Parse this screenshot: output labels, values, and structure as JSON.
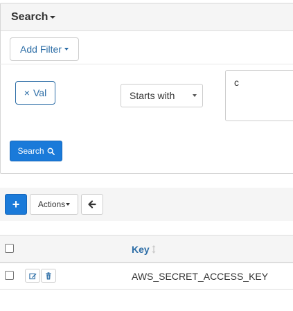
{
  "search": {
    "title": "Search",
    "add_filter_label": "Add Filter",
    "filter_tag_label": "Val",
    "filter_tag_remove": "×",
    "operator_selected": "Starts with",
    "value": "c",
    "search_button_label": "Search"
  },
  "toolbar": {
    "add_label": "+",
    "actions_label": "Actions"
  },
  "table": {
    "columns": [
      "Key"
    ],
    "rows": [
      {
        "key": "AWS_SECRET_ACCESS_KEY"
      }
    ]
  },
  "colors": {
    "primary": "#1a7ad9",
    "link": "#2c6da6",
    "panel_header": "#f5f5f5",
    "border": "#dddddd"
  },
  "icons": [
    "caret-down-icon",
    "remove-icon",
    "select-arrow-icon",
    "search-icon",
    "plus-icon",
    "arrow-left-icon",
    "sort-icon",
    "edit-icon",
    "trash-icon"
  ]
}
